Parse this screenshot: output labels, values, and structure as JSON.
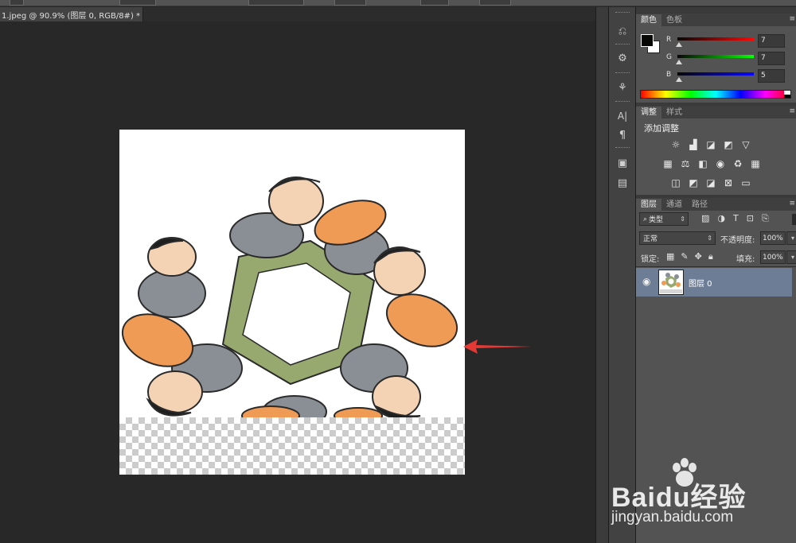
{
  "document": {
    "tab_title": "1.jpeg @ 90.9% (图层 0, RGB/8#) *",
    "close": "×"
  },
  "tools_dock": {
    "icons": [
      {
        "name": "history-icon",
        "glyph": "⎌"
      },
      {
        "name": "properties-icon",
        "glyph": "⚙"
      },
      {
        "name": "brush-presets-icon",
        "glyph": "⚘"
      },
      {
        "name": "character-icon",
        "glyph": "A|"
      },
      {
        "name": "paragraph-icon",
        "glyph": "¶"
      },
      {
        "name": "layer-comps-icon",
        "glyph": "▣"
      },
      {
        "name": "notes-icon",
        "glyph": "▤"
      }
    ]
  },
  "color_panel": {
    "tabs": [
      "颜色",
      "色板"
    ],
    "r_label": "R",
    "g_label": "G",
    "b_label": "B",
    "r_value": "7",
    "g_value": "7",
    "b_value": "5",
    "foreground": "#070705",
    "background": "#ffffff"
  },
  "adjustments_panel": {
    "tabs": [
      "调整",
      "样式"
    ],
    "heading": "添加调整",
    "icons_row1": [
      {
        "name": "brightness-contrast-icon",
        "glyph": "☼"
      },
      {
        "name": "levels-icon",
        "glyph": "▟"
      },
      {
        "name": "curves-icon",
        "glyph": "◪"
      },
      {
        "name": "exposure-icon",
        "glyph": "◩"
      },
      {
        "name": "vibrance-icon",
        "glyph": "▽"
      }
    ],
    "icons_row2": [
      {
        "name": "hue-saturation-icon",
        "glyph": "▦"
      },
      {
        "name": "color-balance-icon",
        "glyph": "⚖"
      },
      {
        "name": "black-white-icon",
        "glyph": "◧"
      },
      {
        "name": "photo-filter-icon",
        "glyph": "◉"
      },
      {
        "name": "channel-mixer-icon",
        "glyph": "♻"
      },
      {
        "name": "color-lookup-icon",
        "glyph": "▦"
      }
    ],
    "icons_row3": [
      {
        "name": "invert-icon",
        "glyph": "◫"
      },
      {
        "name": "posterize-icon",
        "glyph": "◩"
      },
      {
        "name": "threshold-icon",
        "glyph": "◪"
      },
      {
        "name": "selective-color-icon",
        "glyph": "⊠"
      },
      {
        "name": "gradient-map-icon",
        "glyph": "▭"
      }
    ]
  },
  "layers_panel": {
    "tabs": [
      "图层",
      "通道",
      "路径"
    ],
    "filter_kind": "类型",
    "blend_mode": "正常",
    "opacity_label": "不透明度:",
    "opacity_value": "100%",
    "lock_label": "锁定:",
    "fill_label": "填充:",
    "fill_value": "100%",
    "layer_name": "图层 0"
  },
  "watermark": {
    "brand": "Baidu经验",
    "url": "jingyan.baidu.com"
  },
  "colors": {
    "accent_arrow": "#e53935",
    "selected_layer": "#6d7d95"
  }
}
